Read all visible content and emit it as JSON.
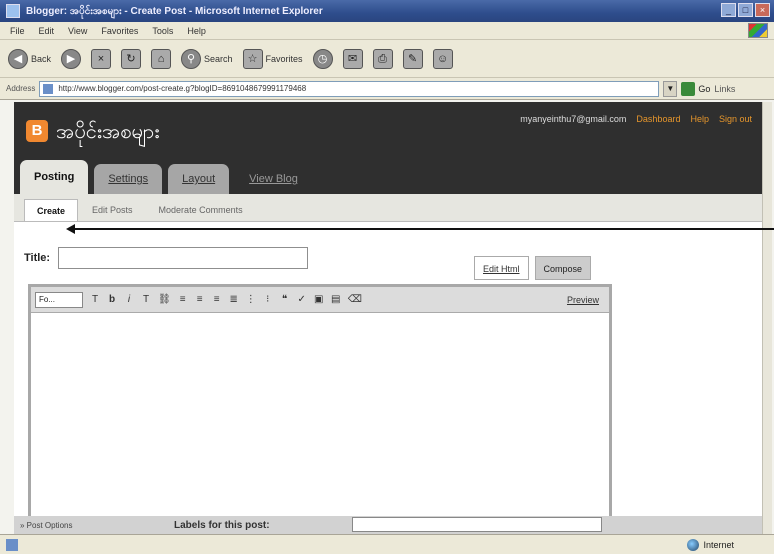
{
  "window": {
    "title": "Blogger: အပိုင်းအစများ - Create Post - Microsoft Internet Explorer"
  },
  "menu": [
    "File",
    "Edit",
    "View",
    "Favorites",
    "Tools",
    "Help"
  ],
  "toolbar": {
    "back_label": "Back",
    "search_label": "Search",
    "favorites_label": "Favorites"
  },
  "address": {
    "label": "Address",
    "url": "http://www.blogger.com/post-create.g?blogID=8691048679991179468",
    "go_label": "Go",
    "links_label": "Links"
  },
  "blog": {
    "logo": "B",
    "title": "အပိုင်းအစများ",
    "user_email": "myanyeinthu7@gmail.com",
    "links": [
      "Dashboard",
      "Help",
      "Sign out"
    ]
  },
  "tabs": [
    "Posting",
    "Settings",
    "Layout",
    "View Blog"
  ],
  "subtabs": [
    "Create",
    "Edit Posts",
    "Moderate Comments"
  ],
  "editor": {
    "title_label": "Title:",
    "title_value": "",
    "mode_tabs": [
      "Edit Html",
      "Compose"
    ],
    "font_label": "Fo...",
    "preview_label": "Preview",
    "labels_label": "Labels for this post:",
    "post_options": "» Post Options"
  },
  "status": {
    "zone": "Internet"
  }
}
